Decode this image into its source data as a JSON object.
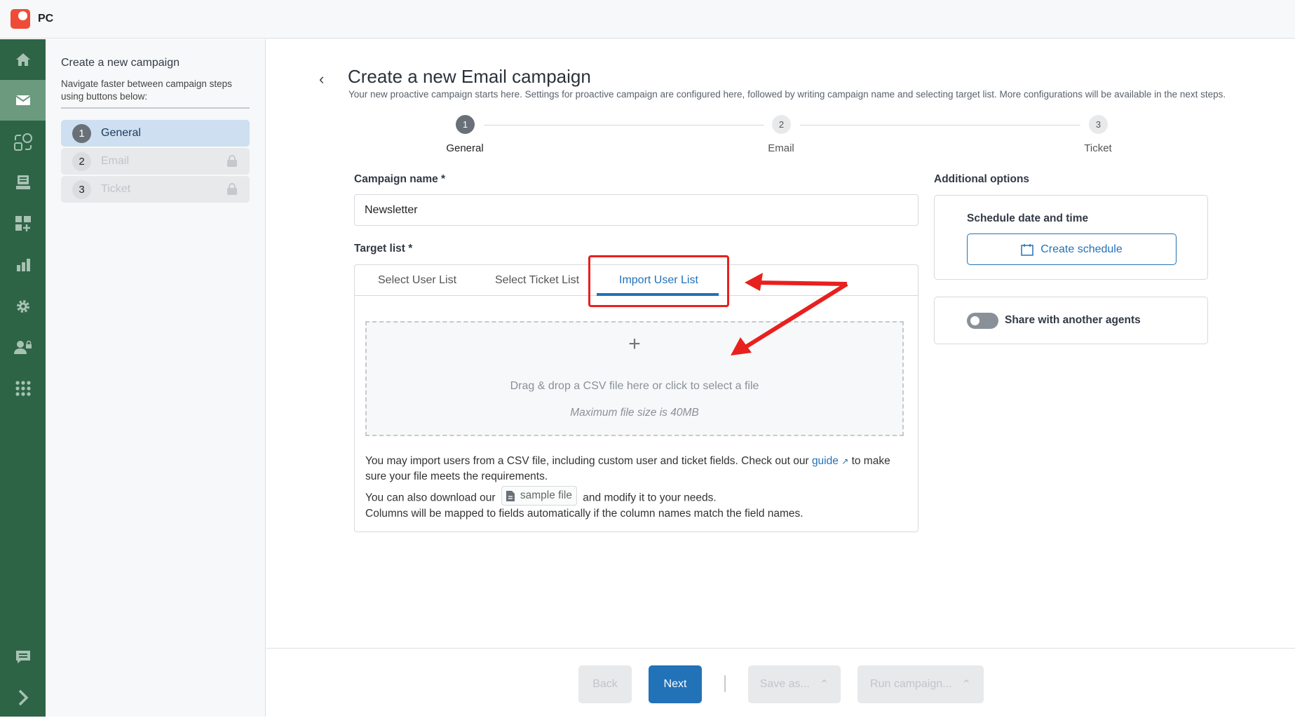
{
  "app": {
    "name": "PC",
    "logo": "pc-logo"
  },
  "rail": {
    "items": [
      {
        "icon": "home-icon"
      },
      {
        "icon": "mail-icon",
        "active": true
      },
      {
        "icon": "shapes-icon"
      },
      {
        "icon": "inbox-icon"
      },
      {
        "icon": "dashboard-add-icon"
      },
      {
        "icon": "bar-chart-icon"
      },
      {
        "icon": "gear-icon"
      },
      {
        "icon": "user-lock-icon"
      },
      {
        "icon": "apps-grid-icon"
      },
      {
        "icon": "chat-icon"
      },
      {
        "icon": "chevron-right-icon"
      }
    ]
  },
  "steps_panel": {
    "title": "Create a new campaign",
    "subtitle": "Navigate faster between campaign steps using buttons below:",
    "items": [
      {
        "num": "1",
        "label": "General",
        "active": true
      },
      {
        "num": "2",
        "label": "Email",
        "locked": true
      },
      {
        "num": "3",
        "label": "Ticket",
        "locked": true
      }
    ]
  },
  "header": {
    "title": "Create a new Email campaign",
    "subtitle": "Your new proactive campaign starts here. Settings for proactive campaign are configured here, followed by writing campaign name and selecting target list. More configurations will be available in the next steps."
  },
  "stepper": [
    {
      "num": "1",
      "label": "General"
    },
    {
      "num": "2",
      "label": "Email"
    },
    {
      "num": "3",
      "label": "Ticket"
    }
  ],
  "form": {
    "campaign_name_label": "Campaign name *",
    "campaign_name_value": "Newsletter",
    "target_list_label": "Target list *",
    "tabs": [
      "Select User List",
      "Select Ticket List",
      "Import User List"
    ],
    "active_tab": "Import User List",
    "drop_text": "Drag & drop a CSV file here or click to select a file",
    "drop_limit": "Maximum file size is 40MB",
    "help1_a": "You may import users from a CSV file, including custom user and ticket fields. Check out our",
    "help1_link": "guide",
    "help1_b": "to make sure your file meets the requirements.",
    "help2_a": "You can also download our",
    "help2_file": "sample file",
    "help2_b": "and modify it to your needs.",
    "help3": "Columns will be mapped to fields automatically if the column names match the field names."
  },
  "options": {
    "title": "Additional options",
    "schedule_label": "Schedule date and time",
    "schedule_button": "Create schedule",
    "share_label": "Share with another agents",
    "share_enabled": false
  },
  "footer": {
    "back": "Back",
    "next": "Next",
    "save_as": "Save as...",
    "run": "Run campaign..."
  },
  "colors": {
    "rail": "#2d6446",
    "accent": "#2272b8",
    "annotation": "#e8201e"
  }
}
